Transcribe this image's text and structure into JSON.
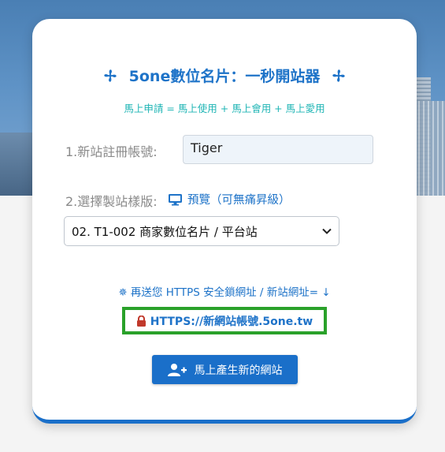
{
  "header": {
    "title": "5one數位名片：一秒開站器",
    "subtitle": "馬上申請 = 馬上使用 + 馬上會用 + 馬上愛用"
  },
  "form": {
    "site_account_label": "1.新站註冊帳號:",
    "site_account_value": "Tiger",
    "template_label": "2.選擇製站樣版:",
    "preview_link": "預覽（可無痛昇級）",
    "template_selected": "02. T1-002 商家數位名片 / 平台站"
  },
  "https": {
    "note": "再送您 HTTPS 安全鎖網址 / 新站網址= ↓",
    "url": "HTTPS://新網站帳號.5one.tw"
  },
  "actions": {
    "create_label": "馬上產生新的網站"
  },
  "colors": {
    "accent": "#1e73c8",
    "subtitle": "#1fb5b5",
    "button": "#1a6fc9",
    "highlight_border": "#2aa12a",
    "lock": "#c0392b"
  },
  "icons": {
    "title_left": "fan-icon",
    "title_right": "fan-icon",
    "preview": "monitor-icon",
    "note": "sparkle-icon",
    "url": "lock-icon",
    "button": "add-user-icon"
  }
}
